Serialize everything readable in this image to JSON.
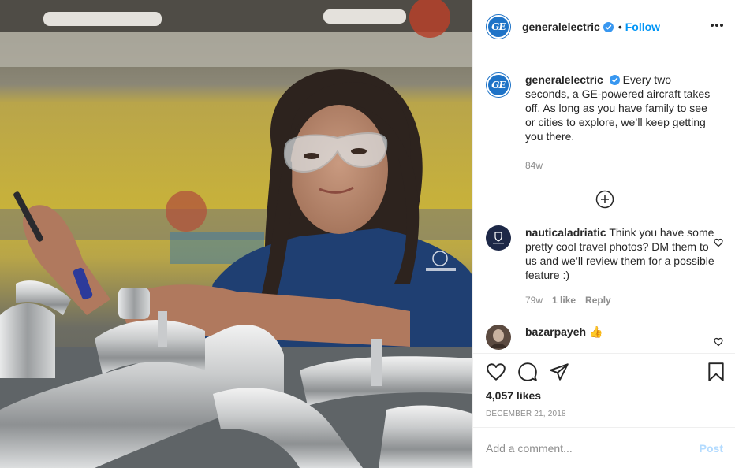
{
  "post": {
    "author": {
      "username": "generalelectric",
      "verified": true,
      "logo_text": "GE",
      "brand_color": "#1e73c7"
    },
    "header": {
      "separator": "•",
      "follow_label": "Follow",
      "more_icon": "more-horizontal-icon"
    },
    "caption": {
      "username": "generalelectric",
      "text": "Every two seconds, a GE-powered aircraft takes off. As long as you have family to see or cities to explore, we’ll keep getting you there.",
      "age": "84w"
    },
    "load_more_icon": "plus-circle-icon",
    "comments": [
      {
        "username": "nauticaladriatic",
        "text": "Think you have some pretty cool travel photos? DM them to us and we’ll review them for a possible feature :)",
        "age": "79w",
        "likes": "1 like",
        "reply_label": "Reply"
      },
      {
        "username": "bazarpayeh",
        "text": "👍"
      }
    ],
    "actions": {
      "like_icon": "heart-icon",
      "comment_icon": "comment-icon",
      "share_icon": "paper-plane-icon",
      "save_icon": "bookmark-icon"
    },
    "likes_count": "4,057 likes",
    "date": "DECEMBER 21, 2018",
    "add_comment": {
      "placeholder": "Add a comment...",
      "post_label": "Post"
    },
    "colors": {
      "link_blue": "#0095f6",
      "post_disabled": "#b3dbff",
      "muted": "#8e8e8e",
      "border": "#efefef"
    }
  }
}
